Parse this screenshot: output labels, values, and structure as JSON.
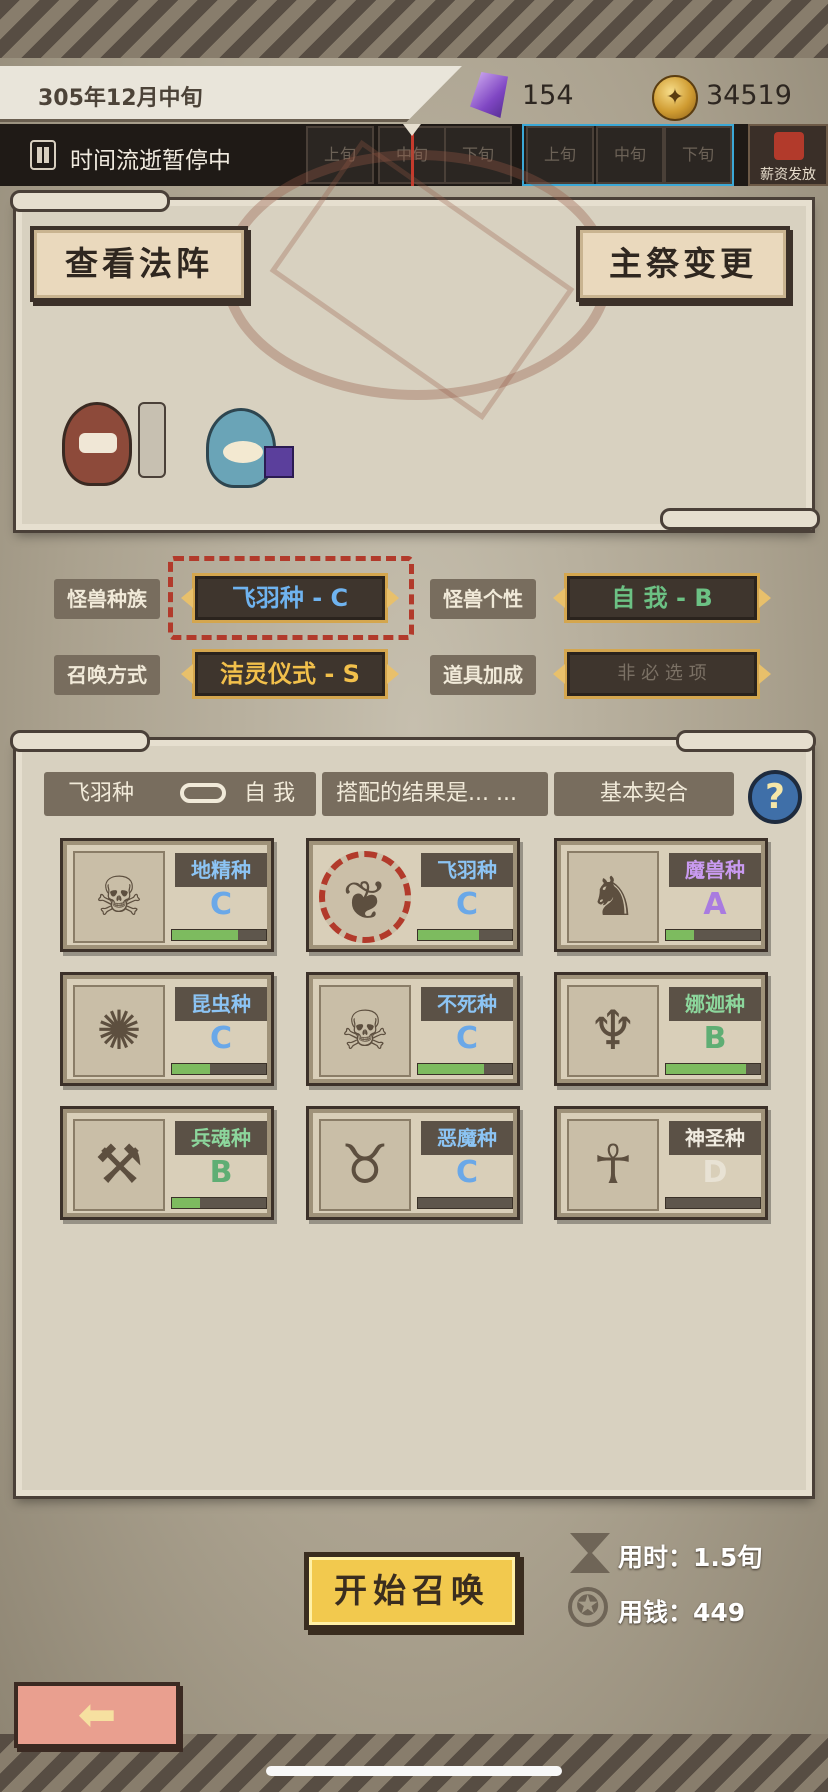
{
  "header": {
    "date": "305年12月中旬",
    "gems": "154",
    "gold": "34519",
    "time_status": "时间流逝暂停中",
    "periods_group1": [
      "上旬",
      "中旬",
      "下旬"
    ],
    "periods_group2": [
      "上旬",
      "中旬",
      "下旬"
    ],
    "payday_label": "薪资发放"
  },
  "stage": {
    "view_circle_label": "查看法阵",
    "change_priest_label": "主祭变更"
  },
  "selections": {
    "race_label": "怪兽种族",
    "race_value": "飞羽种 - C",
    "personality_label": "怪兽个性",
    "personality_value": "自 我 - B",
    "method_label": "召唤方式",
    "method_value": "洁灵仪式 - S",
    "item_label": "道具加成",
    "item_value": "非 必 选 项"
  },
  "info": {
    "tab_race": "飞羽种",
    "tab_personality": "自 我",
    "tab_result": "搭配的结果是... ...",
    "tab_basic": "基本契合",
    "help_icon": "?"
  },
  "races": [
    {
      "name": "地精种",
      "grade": "C",
      "fill": 0.7,
      "grade_color": "#6aa8e8",
      "name_color": "#8cc4f4",
      "icon": "goblin-icon",
      "glyph": "☠"
    },
    {
      "name": "飞羽种",
      "grade": "C",
      "fill": 0.65,
      "grade_color": "#6aa8e8",
      "name_color": "#8cc4f4",
      "icon": "wing-icon",
      "glyph": "❦",
      "selected": true
    },
    {
      "name": "魔兽种",
      "grade": "A",
      "fill": 0.3,
      "grade_color": "#a97be0",
      "name_color": "#c99af0",
      "icon": "beast-icon",
      "glyph": "♞"
    },
    {
      "name": "昆虫种",
      "grade": "C",
      "fill": 0.4,
      "grade_color": "#6aa8e8",
      "name_color": "#8cc4f4",
      "icon": "insect-icon",
      "glyph": "✺"
    },
    {
      "name": "不死种",
      "grade": "C",
      "fill": 0.7,
      "grade_color": "#6aa8e8",
      "name_color": "#8cc4f4",
      "icon": "skull-icon",
      "glyph": "☠"
    },
    {
      "name": "娜迦种",
      "grade": "B",
      "fill": 0.85,
      "grade_color": "#5fae74",
      "name_color": "#8cd69c",
      "icon": "trident-icon",
      "glyph": "♆"
    },
    {
      "name": "兵魂种",
      "grade": "B",
      "fill": 0.3,
      "grade_color": "#5fae74",
      "name_color": "#8cd69c",
      "icon": "axe-icon",
      "glyph": "⚒"
    },
    {
      "name": "恶魔种",
      "grade": "C",
      "fill": 0.0,
      "grade_color": "#6aa8e8",
      "name_color": "#8cc4f4",
      "icon": "demon-icon",
      "glyph": "♉"
    },
    {
      "name": "神圣种",
      "grade": "D",
      "fill": 0.0,
      "grade_color": "#e8e2d4",
      "name_color": "#f0ebe0",
      "icon": "halo-icon",
      "glyph": "☥"
    }
  ],
  "cost": {
    "time": "用时：1.5旬",
    "money": "用钱：449"
  },
  "start_label": "开始召唤",
  "back_glyph": "⬅"
}
